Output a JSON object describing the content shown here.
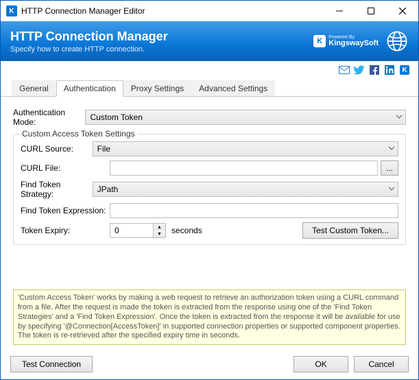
{
  "window": {
    "title": "HTTP Connection Manager Editor"
  },
  "banner": {
    "title": "HTTP Connection Manager",
    "subtitle": "Specify how to create HTTP connection.",
    "logo_powered_by": "Powered By",
    "logo_name": "KingswaySoft"
  },
  "social": {
    "email": "email",
    "twitter": "twitter",
    "facebook": "facebook",
    "linkedin": "linkedin",
    "k": "k"
  },
  "tabs": {
    "general": "General",
    "authentication": "Authentication",
    "proxy": "Proxy Settings",
    "advanced": "Advanced Settings",
    "active": "authentication"
  },
  "fields": {
    "auth_mode_label": "Authentication Mode:",
    "auth_mode_value": "Custom Token",
    "group_title": "Custom Access Token Settings",
    "curl_source_label": "CURL Source:",
    "curl_source_value": "File",
    "curl_file_label": "CURL File:",
    "curl_file_value": "",
    "file_browse": "...",
    "find_token_strategy_label": "Find Token Strategy:",
    "find_token_strategy_value": "JPath",
    "find_token_expression_label": "Find Token Expression:",
    "find_token_expression_value": "",
    "token_expiry_label": "Token Expiry:",
    "token_expiry_value": "0",
    "token_expiry_unit": "seconds",
    "test_custom_token": "Test Custom Token..."
  },
  "info": {
    "text": "'Custom Access Token' works by making a web request to retrieve an authorization token using a CURL command from a file. After the request is made the token is extracted from the response using one of the 'Find Token Strategies' and a 'Find Token Expression'. Once the token is extracted from the response it will be available for use by specifying '@Connection[AccessToken]' in supported connection properties or supported component properties. The token is re-retrieved after the specified expiry time in seconds."
  },
  "footer": {
    "test_connection": "Test Connection",
    "ok": "OK",
    "cancel": "Cancel"
  }
}
